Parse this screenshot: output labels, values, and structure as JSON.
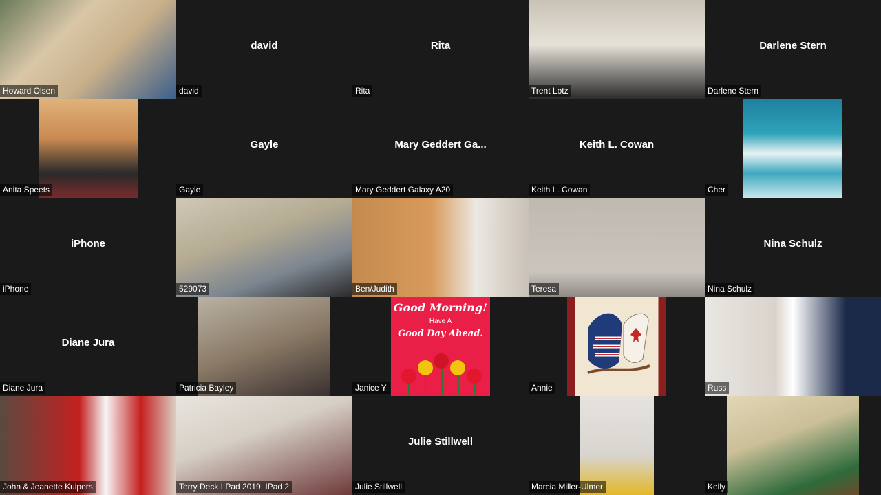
{
  "participants": [
    {
      "name": "Howard Olsen",
      "video": true
    },
    {
      "name": "david",
      "video": false,
      "center_name": "david"
    },
    {
      "name": "Rita",
      "video": false,
      "center_name": "Rita"
    },
    {
      "name": "Trent Lotz",
      "video": true
    },
    {
      "name": "Darlene Stern",
      "video": false,
      "center_name": "Darlene Stern"
    },
    {
      "name": "Anita Speets",
      "video": true
    },
    {
      "name": "Gayle",
      "video": false,
      "center_name": "Gayle"
    },
    {
      "name": "Mary Geddert  Galaxy A20",
      "video": false,
      "center_name": "Mary Geddert  Ga..."
    },
    {
      "name": "Keith L. Cowan",
      "video": false,
      "center_name": "Keith L. Cowan"
    },
    {
      "name": "Cher",
      "video": true
    },
    {
      "name": "iPhone",
      "video": false,
      "center_name": "iPhone"
    },
    {
      "name": "529073",
      "video": true
    },
    {
      "name": "Ben/Judith",
      "video": true
    },
    {
      "name": "Teresa",
      "video": true
    },
    {
      "name": "Nina Schulz",
      "video": false,
      "center_name": "Nina Schulz"
    },
    {
      "name": "Diane Jura",
      "video": false,
      "center_name": "Diane Jura"
    },
    {
      "name": "Patricia Bayley",
      "video": true
    },
    {
      "name": "Janice Y",
      "video": true
    },
    {
      "name": "Annie",
      "video": true
    },
    {
      "name": "Russ",
      "video": true
    },
    {
      "name": "John & Jeanette Kuipers",
      "video": true
    },
    {
      "name": "Terry Deck I Pad 2019. IPad 2",
      "video": true
    },
    {
      "name": "Julie Stillwell",
      "video": false,
      "center_name": "Julie Stillwell"
    },
    {
      "name": "Marcia Miller-Ulmer",
      "video": true
    },
    {
      "name": "Kelly",
      "video": true
    }
  ],
  "janice_card": {
    "line1": "Good Morning!",
    "line2": "Have A",
    "line3": "Good Day Ahead."
  },
  "colors": {
    "background": "#1a1a1a",
    "label_bg": "rgba(0,0,0,0.55)",
    "text": "#ffffff"
  }
}
